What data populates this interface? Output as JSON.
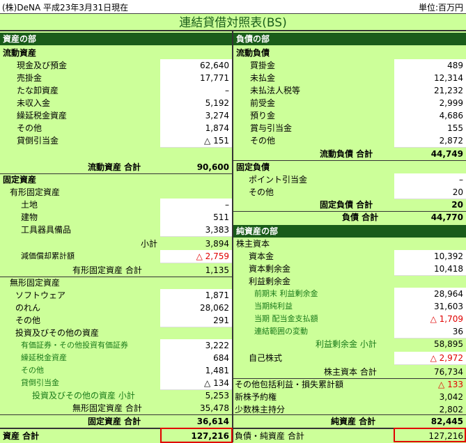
{
  "header": {
    "left": "(株)DeNA 平成23年3月31日現在",
    "right": "単位:百万円"
  },
  "title": "連結貸借対照表(BS)",
  "assets": {
    "header": "資産の部",
    "current_title": "流動資産",
    "current": [
      {
        "label": "現金及び預金",
        "value": "62,640"
      },
      {
        "label": "売掛金",
        "value": "17,771"
      },
      {
        "label": "たな卸資産",
        "value": "–"
      },
      {
        "label": "未収入金",
        "value": "5,192"
      },
      {
        "label": "繰延税金資産",
        "value": "3,274"
      },
      {
        "label": "その他",
        "value": "1,874"
      },
      {
        "label": "貸倒引当金",
        "value": "△ 151"
      }
    ],
    "current_total_label": "流動資産 合計",
    "current_total": "90,600",
    "fixed_title": "固定資産",
    "tangible_title": "有形固定資産",
    "tangible": [
      {
        "label": "土地",
        "value": "–"
      },
      {
        "label": "建物",
        "value": "511"
      },
      {
        "label": "工具器具備品",
        "value": "3,383"
      }
    ],
    "tangible_subtotal_label": "小計",
    "tangible_subtotal": "3,894",
    "depreciation_label": "減価償却累計額",
    "depreciation": "△ 2,759",
    "tangible_total_label": "有形固定資産 合計",
    "tangible_total": "1,135",
    "intangible_title": "無形固定資産",
    "intangible": [
      {
        "label": "ソフトウェア",
        "value": "1,871"
      },
      {
        "label": "のれん",
        "value": "28,062"
      },
      {
        "label": "その他",
        "value": "291"
      }
    ],
    "investment_title": "投資及びその他の資産",
    "investment": [
      {
        "label": "有価証券・その他投資有価証券",
        "value": "3,222"
      },
      {
        "label": "繰延税金資産",
        "value": "684"
      },
      {
        "label": "その他",
        "value": "1,481"
      },
      {
        "label": "貸倒引当金",
        "value": "△ 134"
      }
    ],
    "investment_total_label": "投資及びその他の資産 小計",
    "investment_total": "5,253",
    "intangible_total_label": "無形固定資産 合計",
    "intangible_total": "35,478",
    "fixed_total_label": "固定資産 合計",
    "fixed_total": "36,614",
    "total_label": "資産 合計",
    "total": "127,216"
  },
  "liabilities": {
    "header": "負債の部",
    "current_title": "流動負債",
    "current": [
      {
        "label": "買掛金",
        "value": "489"
      },
      {
        "label": "未払金",
        "value": "12,314"
      },
      {
        "label": "未払法人税等",
        "value": "21,232"
      },
      {
        "label": "前受金",
        "value": "2,999"
      },
      {
        "label": "預り金",
        "value": "4,686"
      },
      {
        "label": "賞与引当金",
        "value": "155"
      },
      {
        "label": "その他",
        "value": "2,872"
      }
    ],
    "current_total_label": "流動負債 合計",
    "current_total": "44,749",
    "fixed_title": "固定負債",
    "fixed": [
      {
        "label": "ポイント引当金",
        "value": "–"
      },
      {
        "label": "その他",
        "value": "20"
      }
    ],
    "fixed_total_label": "固定負債 合計",
    "fixed_total": "20",
    "total_label": "負債 合計",
    "total": "44,770"
  },
  "equity": {
    "header": "純資産の部",
    "shareholders_title": "株主資本",
    "capital_label": "資本金",
    "capital": "10,392",
    "surplus_label": "資本剰余金",
    "surplus": "10,418",
    "retained_title": "利益剰余金",
    "retained": [
      {
        "label": "前期末 利益剰余金",
        "value": "28,964"
      },
      {
        "label": "当期純利益",
        "value": "31,603"
      },
      {
        "label": "当期 配当金支払額",
        "value": "△ 1,709"
      },
      {
        "label": "連結範囲の変動",
        "value": "36"
      }
    ],
    "retained_subtotal_label": "利益剰余金 小計",
    "retained_subtotal": "58,895",
    "treasury_label": "自己株式",
    "treasury": "△ 2,972",
    "shareholders_total_label": "株主資本 合計",
    "shareholders_total": "76,734",
    "oci_label": "その他包括利益・損失累計額",
    "oci": "△ 133",
    "warrants_label": "新株予約権",
    "warrants": "3,042",
    "minority_label": "少数株主持分",
    "minority": "2,802",
    "total_label": "純資産 合計",
    "total": "82,445",
    "grand_total_label": "負債・純資産 合計",
    "grand_total": "127,216"
  }
}
